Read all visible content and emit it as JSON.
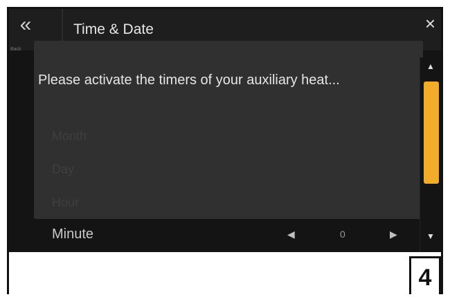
{
  "header": {
    "back_glyph": "«",
    "back_caption": "Back",
    "title": "Time & Date",
    "close_glyph": "×"
  },
  "dialog": {
    "message": "Please activate the timers of your auxiliary heat..."
  },
  "list": {
    "faded_rows": [
      "Month",
      "Day",
      "Hour"
    ],
    "minute": {
      "label": "Minute",
      "value": "0",
      "left_arrow": "◀",
      "right_arrow": "▶"
    }
  },
  "scrollbar": {
    "up_arrow": "▲",
    "down_arrow": "▼",
    "thumb_color": "#f3ab2a",
    "position_fraction": 0.2
  },
  "page": {
    "number": "4"
  }
}
